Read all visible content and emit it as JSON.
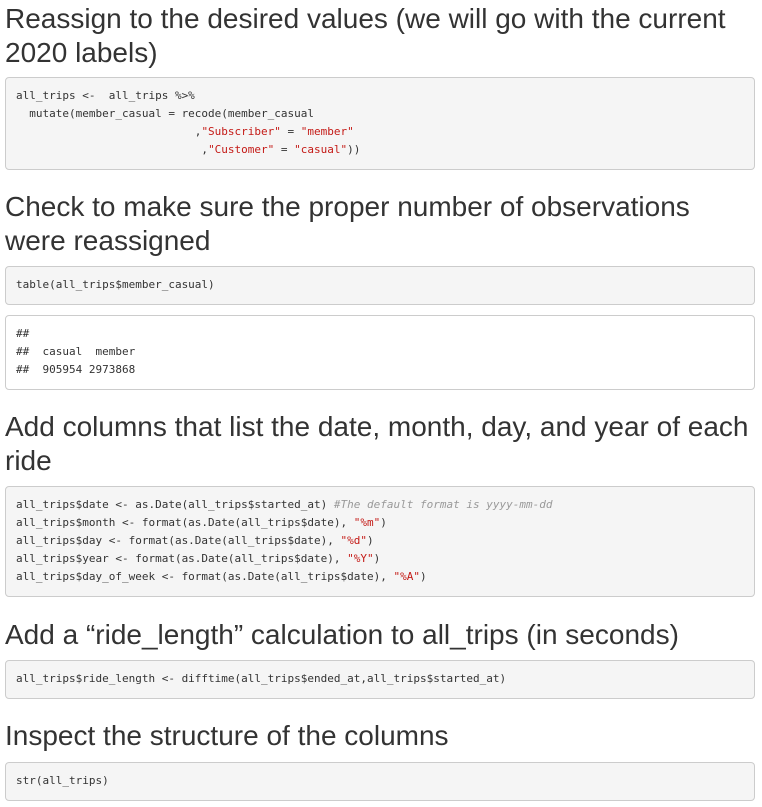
{
  "sections": [
    {
      "heading": "Reassign to the desired values (we will go with the current 2020 labels)",
      "code": [
        [
          {
            "t": "all_trips <-  all_trips %>%",
            "k": "plain"
          }
        ],
        [
          {
            "t": "  mutate(member_casual = recode(member_casual",
            "k": "plain"
          }
        ],
        [
          {
            "t": "                           ,",
            "k": "plain"
          },
          {
            "t": "\"Subscriber\"",
            "k": "str"
          },
          {
            "t": " = ",
            "k": "plain"
          },
          {
            "t": "\"member\"",
            "k": "str"
          }
        ],
        [
          {
            "t": "                            ,",
            "k": "plain"
          },
          {
            "t": "\"Customer\"",
            "k": "str"
          },
          {
            "t": " = ",
            "k": "plain"
          },
          {
            "t": "\"casual\"",
            "k": "str"
          },
          {
            "t": "))",
            "k": "plain"
          }
        ]
      ]
    },
    {
      "heading": "Check to make sure the proper number of observations were reassigned",
      "code": [
        [
          {
            "t": "table(all_trips$member_casual)",
            "k": "plain"
          }
        ]
      ],
      "output": [
        "##",
        "##  casual  member",
        "##  905954 2973868"
      ]
    },
    {
      "heading": "Add columns that list the date, month, day, and year of each ride",
      "code": [
        [
          {
            "t": "all_trips$date <- as.Date(all_trips$started_at) ",
            "k": "plain"
          },
          {
            "t": "#The default format is yyyy-mm-dd",
            "k": "com"
          }
        ],
        [
          {
            "t": "all_trips$month <- format(as.Date(all_trips$date), ",
            "k": "plain"
          },
          {
            "t": "\"%m\"",
            "k": "str"
          },
          {
            "t": ")",
            "k": "plain"
          }
        ],
        [
          {
            "t": "all_trips$day <- format(as.Date(all_trips$date), ",
            "k": "plain"
          },
          {
            "t": "\"%d\"",
            "k": "str"
          },
          {
            "t": ")",
            "k": "plain"
          }
        ],
        [
          {
            "t": "all_trips$year <- format(as.Date(all_trips$date), ",
            "k": "plain"
          },
          {
            "t": "\"%Y\"",
            "k": "str"
          },
          {
            "t": ")",
            "k": "plain"
          }
        ],
        [
          {
            "t": "all_trips$day_of_week <- format(as.Date(all_trips$date), ",
            "k": "plain"
          },
          {
            "t": "\"%A\"",
            "k": "str"
          },
          {
            "t": ")",
            "k": "plain"
          }
        ]
      ]
    },
    {
      "heading": "Add a “ride_length” calculation to all_trips (in seconds)",
      "code": [
        [
          {
            "t": "all_trips$ride_length <- difftime(all_trips$ended_at,all_trips$started_at)",
            "k": "plain"
          }
        ]
      ]
    },
    {
      "heading": "Inspect the structure of the columns",
      "code": [
        [
          {
            "t": "str(all_trips)",
            "k": "plain"
          }
        ]
      ]
    }
  ],
  "colors": {
    "text": "#333333",
    "string": "#c41a16",
    "comment": "#999999",
    "code_background": "#f5f5f5",
    "output_background": "#ffffff",
    "border": "#cccccc"
  }
}
